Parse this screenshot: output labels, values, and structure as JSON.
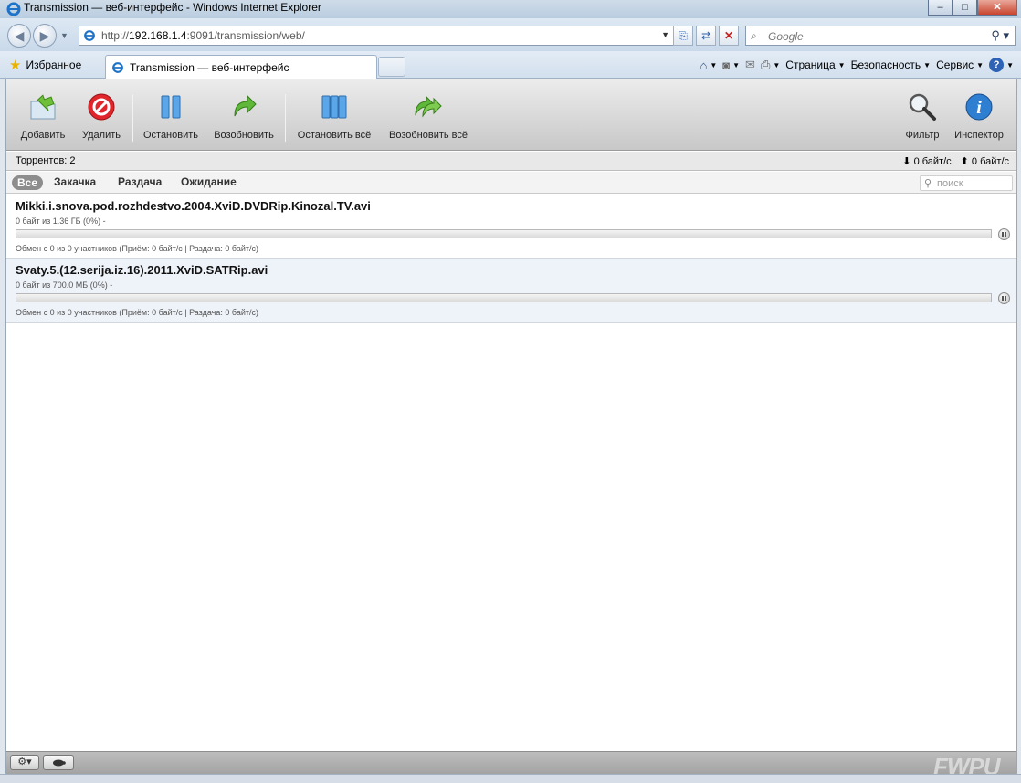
{
  "window": {
    "title": "Transmission — веб-интерфейс - Windows Internet Explorer",
    "buttons": [
      "–",
      "□",
      "✕"
    ]
  },
  "address_bar": {
    "url_prefix": "http://",
    "url_host": "192.168.1.4",
    "url_rest": ":9091/transmission/web/",
    "search_placeholder": "Google"
  },
  "tab_row": {
    "favorites_label": "Избранное",
    "active_tab_label": "Transmission — веб-интерфейс",
    "commands": {
      "page": "Страница",
      "safety": "Безопасность",
      "tools": "Сервис"
    }
  },
  "toolbar": {
    "add": "Добавить",
    "remove": "Удалить",
    "pause": "Остановить",
    "resume": "Возобновить",
    "pause_all": "Остановить всё",
    "resume_all": "Возобновить всё",
    "filter": "Фильтр",
    "inspector": "Инспектор"
  },
  "status": {
    "torrent_count": "Торрентов: 2",
    "download_speed": "0 байт/с",
    "upload_speed": "0 байт/с"
  },
  "filters": {
    "all": "Все",
    "downloading": "Закачка",
    "seeding": "Раздача",
    "paused": "Ожидание",
    "search_placeholder": "поиск"
  },
  "torrents": [
    {
      "name": "Mikki.i.snova.pod.rozhdestvo.2004.XviD.DVDRip.Kinozal.TV.avi",
      "progress_text": "0 байт из 1.36 ГБ (0%) -",
      "progress": 0,
      "peers_text": "Обмен с 0 из 0 участников (Приём: 0 байт/с | Раздача: 0 байт/с)"
    },
    {
      "name": "Svaty.5.(12.serija.iz.16).2011.XviD.SATRip.avi",
      "progress_text": "0 байт из 700.0 МБ (0%) -",
      "progress": 0,
      "peers_text": "Обмен с 0 из 0 участников (Приём: 0 байт/с | Раздача: 0 байт/с)"
    }
  ],
  "bottom_bar": {
    "settings_icon": "gear-icon",
    "turtle_icon": "turtle-icon"
  },
  "watermark": "FWPU",
  "colors": {
    "accent_blue": "#2d62b5",
    "row_alt": "#eef2f9",
    "toolbar_gray": "#c8c8c8"
  }
}
